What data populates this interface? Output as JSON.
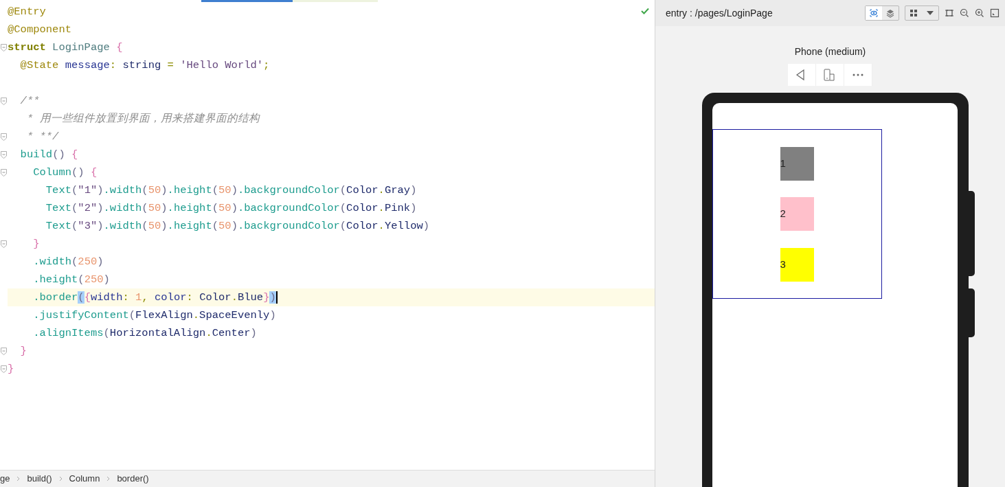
{
  "editor": {
    "saved": true,
    "lines": [
      {
        "kind": "code",
        "tokens": [
          {
            "text": "@Entry",
            "kind": "ann"
          }
        ]
      },
      {
        "kind": "code",
        "tokens": [
          {
            "text": "@Component",
            "kind": "ann"
          }
        ]
      },
      {
        "kind": "code",
        "fold": true,
        "tokens": [
          {
            "text": "struct",
            "kind": "kw"
          },
          {
            "text": " LoginPage ",
            "kind": "type"
          },
          {
            "text": "{",
            "kind": "brace"
          }
        ]
      },
      {
        "kind": "code",
        "tokens": [
          {
            "text": "  @State",
            "kind": "ann"
          },
          {
            "text": " message",
            "kind": "field"
          },
          {
            "text": ": ",
            "kind": "punct"
          },
          {
            "text": "string",
            "kind": "typ2"
          },
          {
            "text": " = ",
            "kind": "punct"
          },
          {
            "text": "'Hello World'",
            "kind": "str"
          },
          {
            "text": ";",
            "kind": "punct"
          }
        ]
      },
      {
        "kind": "blank"
      },
      {
        "kind": "code",
        "fold": true,
        "tokens": [
          {
            "text": "  /**",
            "kind": "cmt"
          }
        ]
      },
      {
        "kind": "code",
        "tokens": [
          {
            "text": "   * 用一些组件放置到界面，用来搭建界面的结构",
            "kind": "cmt"
          }
        ]
      },
      {
        "kind": "code",
        "fold": true,
        "tokens": [
          {
            "text": "   * **/",
            "kind": "cmt"
          }
        ]
      },
      {
        "kind": "code",
        "fold": true,
        "tokens": [
          {
            "text": "  build",
            "kind": "fn"
          },
          {
            "text": "() ",
            "kind": "paren"
          },
          {
            "text": "{",
            "kind": "brace"
          }
        ]
      },
      {
        "kind": "code",
        "fold": true,
        "tokens": [
          {
            "text": "    Column",
            "kind": "fn"
          },
          {
            "text": "() ",
            "kind": "paren"
          },
          {
            "text": "{",
            "kind": "brace"
          }
        ]
      },
      {
        "kind": "code",
        "tokens": [
          {
            "text": "      Text",
            "kind": "fn"
          },
          {
            "text": "(",
            "kind": "paren"
          },
          {
            "text": "\"1\"",
            "kind": "str"
          },
          {
            "text": ")",
            "kind": "paren"
          },
          {
            "text": ".width",
            "kind": "fn"
          },
          {
            "text": "(",
            "kind": "paren"
          },
          {
            "text": "50",
            "kind": "num"
          },
          {
            "text": ")",
            "kind": "paren"
          },
          {
            "text": ".height",
            "kind": "fn"
          },
          {
            "text": "(",
            "kind": "paren"
          },
          {
            "text": "50",
            "kind": "num"
          },
          {
            "text": ")",
            "kind": "paren"
          },
          {
            "text": ".backgroundColor",
            "kind": "fn"
          },
          {
            "text": "(",
            "kind": "paren"
          },
          {
            "text": "Color",
            "kind": "typ2"
          },
          {
            "text": ".",
            "kind": "punct"
          },
          {
            "text": "Gray",
            "kind": "typ2"
          },
          {
            "text": ")",
            "kind": "paren"
          }
        ]
      },
      {
        "kind": "code",
        "tokens": [
          {
            "text": "      Text",
            "kind": "fn"
          },
          {
            "text": "(",
            "kind": "paren"
          },
          {
            "text": "\"2\"",
            "kind": "str"
          },
          {
            "text": ")",
            "kind": "paren"
          },
          {
            "text": ".width",
            "kind": "fn"
          },
          {
            "text": "(",
            "kind": "paren"
          },
          {
            "text": "50",
            "kind": "num"
          },
          {
            "text": ")",
            "kind": "paren"
          },
          {
            "text": ".height",
            "kind": "fn"
          },
          {
            "text": "(",
            "kind": "paren"
          },
          {
            "text": "50",
            "kind": "num"
          },
          {
            "text": ")",
            "kind": "paren"
          },
          {
            "text": ".backgroundColor",
            "kind": "fn"
          },
          {
            "text": "(",
            "kind": "paren"
          },
          {
            "text": "Color",
            "kind": "typ2"
          },
          {
            "text": ".",
            "kind": "punct"
          },
          {
            "text": "Pink",
            "kind": "typ2"
          },
          {
            "text": ")",
            "kind": "paren"
          }
        ]
      },
      {
        "kind": "code",
        "tokens": [
          {
            "text": "      Text",
            "kind": "fn"
          },
          {
            "text": "(",
            "kind": "paren"
          },
          {
            "text": "\"3\"",
            "kind": "str"
          },
          {
            "text": ")",
            "kind": "paren"
          },
          {
            "text": ".width",
            "kind": "fn"
          },
          {
            "text": "(",
            "kind": "paren"
          },
          {
            "text": "50",
            "kind": "num"
          },
          {
            "text": ")",
            "kind": "paren"
          },
          {
            "text": ".height",
            "kind": "fn"
          },
          {
            "text": "(",
            "kind": "paren"
          },
          {
            "text": "50",
            "kind": "num"
          },
          {
            "text": ")",
            "kind": "paren"
          },
          {
            "text": ".backgroundColor",
            "kind": "fn"
          },
          {
            "text": "(",
            "kind": "paren"
          },
          {
            "text": "Color",
            "kind": "typ2"
          },
          {
            "text": ".",
            "kind": "punct"
          },
          {
            "text": "Yellow",
            "kind": "typ2"
          },
          {
            "text": ")",
            "kind": "paren"
          }
        ]
      },
      {
        "kind": "code",
        "fold": true,
        "tokens": [
          {
            "text": "    }",
            "kind": "brace"
          }
        ]
      },
      {
        "kind": "code",
        "tokens": [
          {
            "text": "    .width",
            "kind": "fn"
          },
          {
            "text": "(",
            "kind": "paren"
          },
          {
            "text": "250",
            "kind": "num"
          },
          {
            "text": ")",
            "kind": "paren"
          }
        ]
      },
      {
        "kind": "code",
        "tokens": [
          {
            "text": "    .height",
            "kind": "fn"
          },
          {
            "text": "(",
            "kind": "paren"
          },
          {
            "text": "250",
            "kind": "num"
          },
          {
            "text": ")",
            "kind": "paren"
          }
        ]
      },
      {
        "kind": "code",
        "current": true,
        "tokens": [
          {
            "text": "    .border",
            "kind": "fn"
          },
          {
            "text": "(",
            "kind": "paren",
            "matched": true
          },
          {
            "text": "{",
            "kind": "brace"
          },
          {
            "text": "width",
            "kind": "field"
          },
          {
            "text": ": ",
            "kind": "punct"
          },
          {
            "text": "1",
            "kind": "num"
          },
          {
            "text": ", ",
            "kind": "punct"
          },
          {
            "text": "color",
            "kind": "field"
          },
          {
            "text": ": ",
            "kind": "punct"
          },
          {
            "text": "Color",
            "kind": "typ2"
          },
          {
            "text": ".",
            "kind": "punct"
          },
          {
            "text": "Blue",
            "kind": "typ2"
          },
          {
            "text": "}",
            "kind": "brace"
          },
          {
            "text": ")",
            "kind": "paren",
            "matched": true
          }
        ]
      },
      {
        "kind": "code",
        "tokens": [
          {
            "text": "    .justifyContent",
            "kind": "fn"
          },
          {
            "text": "(",
            "kind": "paren"
          },
          {
            "text": "FlexAlign",
            "kind": "typ2"
          },
          {
            "text": ".",
            "kind": "punct"
          },
          {
            "text": "SpaceEvenly",
            "kind": "typ2"
          },
          {
            "text": ")",
            "kind": "paren"
          }
        ]
      },
      {
        "kind": "code",
        "tokens": [
          {
            "text": "    .alignItems",
            "kind": "fn"
          },
          {
            "text": "(",
            "kind": "paren"
          },
          {
            "text": "HorizontalAlign",
            "kind": "typ2"
          },
          {
            "text": ".",
            "kind": "punct"
          },
          {
            "text": "Center",
            "kind": "typ2"
          },
          {
            "text": ")",
            "kind": "paren"
          }
        ]
      },
      {
        "kind": "code",
        "fold": true,
        "tokens": [
          {
            "text": "  }",
            "kind": "brace"
          }
        ]
      },
      {
        "kind": "code",
        "fold": true,
        "tokens": [
          {
            "text": "}",
            "kind": "brace"
          }
        ]
      }
    ]
  },
  "breadcrumb": [
    "ge",
    "build()",
    "Column",
    "border()"
  ],
  "preview": {
    "title": "entry : /pages/LoginPage",
    "toolbar": [
      {
        "kind": "inspect",
        "selected": true
      },
      {
        "kind": "layers",
        "selected": false
      },
      {
        "kind": "grid",
        "selected": false
      }
    ],
    "device": "Phone (medium)",
    "column_items": [
      {
        "label": "1",
        "color": "#808080"
      },
      {
        "label": "2",
        "color": "#ffc0cb"
      },
      {
        "label": "3",
        "color": "#ffff00"
      }
    ]
  }
}
